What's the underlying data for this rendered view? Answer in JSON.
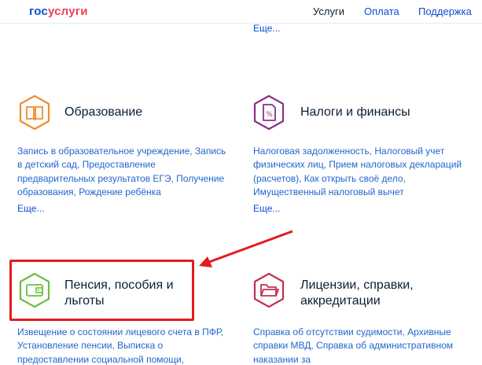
{
  "header": {
    "logo": {
      "part1": "гос",
      "part2": "услуги"
    },
    "nav": {
      "services": "Услуги",
      "payment": "Оплата",
      "support": "Поддержка"
    }
  },
  "top_more_link": "Еще...",
  "categories": [
    {
      "title": "Образование",
      "icon": "book-icon",
      "icon_color": "#f08c2b",
      "description": "Запись в образовательное учреждение, Запись в детский сад, Предоставление предварительных результатов ЕГЭ, Получение образования, Рождение ребёнка",
      "more": "Еще..."
    },
    {
      "title": "Налоги и финансы",
      "icon": "tax-document-icon",
      "icon_color": "#8a2f86",
      "description": "Налоговая задолженность, Налоговый учет физических лиц, Прием налоговых деклараций (расчетов), Как открыть своё дело, Имущественный налоговый вычет",
      "more": "Еще..."
    },
    {
      "title_line1": "Пенсия, пособия и",
      "title_line2": "льготы",
      "icon": "wallet-icon",
      "icon_color": "#6cbf3e",
      "description": "Извещение о состоянии лицевого счета в ПФР, Установление пенсии, Выписка о предоставлении социальной помощи,"
    },
    {
      "title_line1": "Лицензии, справки,",
      "title_line2": "аккредитации",
      "icon": "folder-icon",
      "icon_color": "#c0304f",
      "description": "Справка об отсутствии судимости, Архивные справки МВД, Справка об административном наказании за"
    }
  ],
  "annotation": {
    "highlight_color": "#e31b1b",
    "arrow_color": "#e31b1b"
  }
}
